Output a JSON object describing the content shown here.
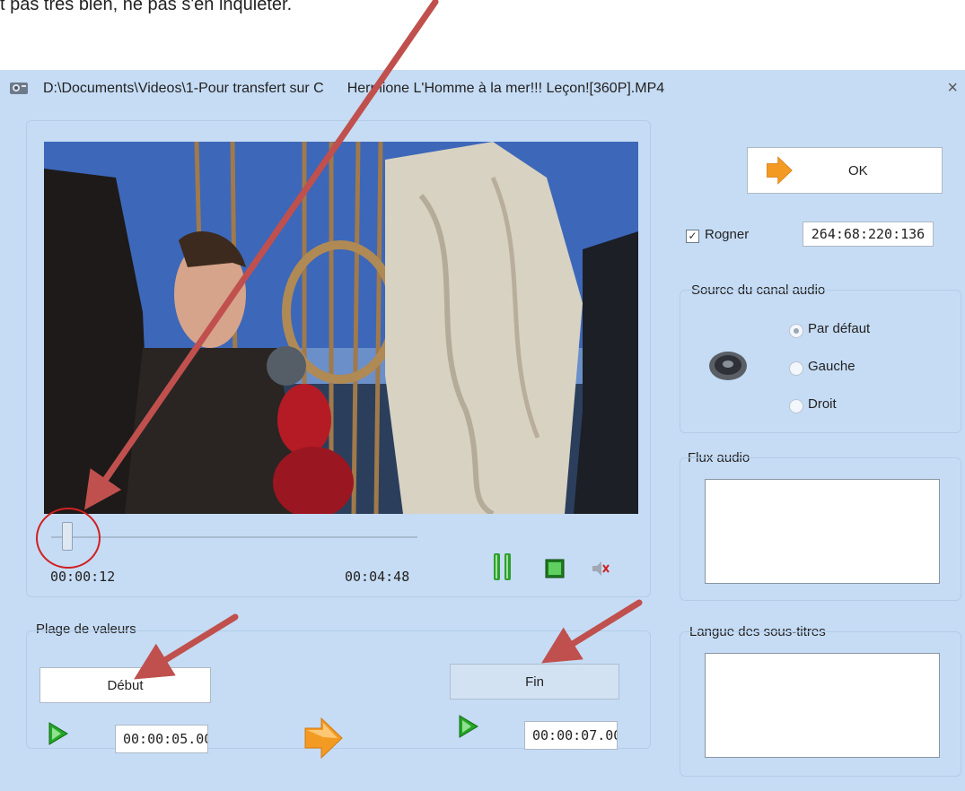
{
  "caption": {
    "text": "t pas très bien, ne pas s'en inquiéter."
  },
  "window": {
    "title": "D:\\Documents\\Videos\\1-Pour transfert sur C",
    "title_rest": "Hermione  L'Homme à la mer!!! Leçon![360P].MP4",
    "close_label": "×"
  },
  "player": {
    "current_time": "00:00:12",
    "duration": "00:04:48",
    "position_fraction": 0.04
  },
  "range": {
    "group_label": "Plage de valeurs",
    "start_button": "Début",
    "end_button": "Fin",
    "start_time": "00:00:05.00",
    "end_time": "00:00:07.00"
  },
  "ok_button": {
    "label": "OK"
  },
  "crop": {
    "label": "Rogner",
    "checked": true,
    "value": "264:68:220:136"
  },
  "audio_source": {
    "label": "Source du canal audio",
    "options": [
      "Par défaut",
      "Gauche",
      "Droit"
    ],
    "selected": "Par défaut"
  },
  "audio_stream": {
    "label": "Flux audio"
  },
  "subtitles": {
    "label": "Langue des sous-titres"
  },
  "colors": {
    "window_bg": "#c6dcf5",
    "annotation_red": "#c0504d",
    "play_green": "#22aa22",
    "orange_arrow": "#f59a23"
  }
}
